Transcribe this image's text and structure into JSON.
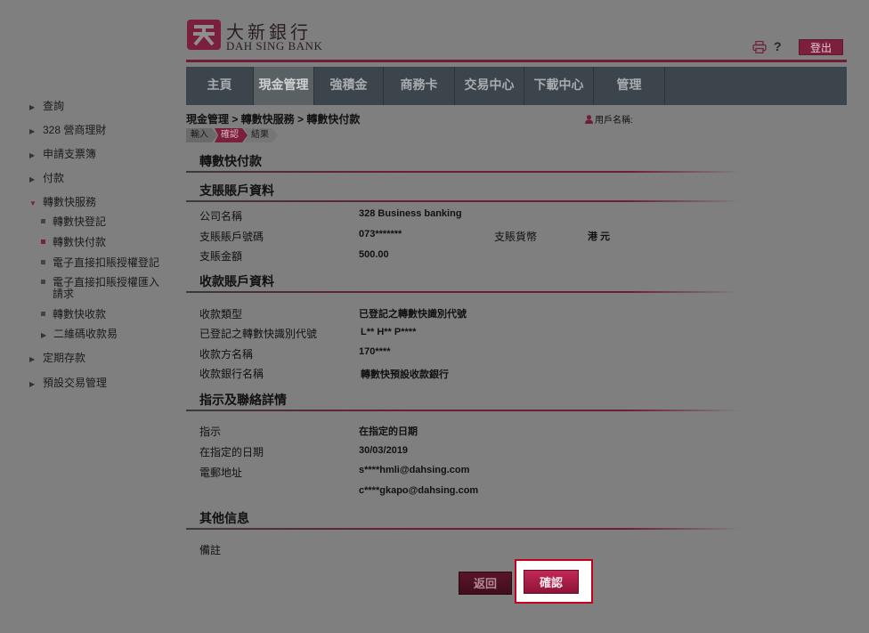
{
  "brand": {
    "name_cn": "大新銀行",
    "name_en": "DAH SING BANK",
    "color": "#7a1f3c"
  },
  "header": {
    "help_label": "?",
    "logout_label": "登出",
    "print_icon": "printer-icon"
  },
  "nav": {
    "items": [
      {
        "label": "主頁"
      },
      {
        "label": "現金管理"
      },
      {
        "label": "強積金"
      },
      {
        "label": "商務卡"
      },
      {
        "label": "交易中心"
      },
      {
        "label": "下載中心"
      },
      {
        "label": "管理"
      }
    ],
    "active": "現金管理"
  },
  "breadcrumb": "現金管理 > 轉數快服務 > 轉數快付款",
  "user": {
    "label": "用戶名稱:"
  },
  "steps": [
    "輸入",
    "確認",
    "結果"
  ],
  "page_title": "轉數快付款",
  "debit": {
    "title": "支賬賬戶資料",
    "company_label": "公司名稱",
    "company_value": "328 Business banking",
    "account_label": "支賬賬戶號碼",
    "account_value": "073*******",
    "currency_label": "支賬貨幣",
    "currency_value": "港 元",
    "amount_label": "支賬金額",
    "amount_value": "500.00"
  },
  "payee": {
    "title": "收款賬戶資料",
    "type_label": "收款類型",
    "type_value": "已登記之轉數快識別代號",
    "proxy_label": "已登記之轉數快識別代號",
    "proxy_value": "L** H** P****",
    "name_label": "收款方名稱",
    "name_value": "170****",
    "bank_label": "收款銀行名稱",
    "bank_value": "轉數快預設收款銀行"
  },
  "instruction": {
    "title": "指示及聯絡詳情",
    "instr_label": "指示",
    "instr_value": "在指定的日期",
    "date_label": "在指定的日期",
    "date_value": "30/03/2019",
    "email_label": "電郵地址",
    "email_1": "s****hmli@dahsing.com",
    "email_2": "c****gkapo@dahsing.com"
  },
  "other": {
    "title": "其他信息",
    "remark_label": "備註"
  },
  "buttons": {
    "back": "返回",
    "confirm": "確認"
  },
  "sidebar": {
    "items": [
      {
        "label": "查詢"
      },
      {
        "label": "328 營商理財"
      },
      {
        "label": "申請支票簿"
      },
      {
        "label": "付款"
      },
      {
        "label": "轉數快服務"
      },
      {
        "label": "定期存款"
      },
      {
        "label": "預設交易管理"
      }
    ],
    "fps_sub": [
      {
        "label": "轉數快登記"
      },
      {
        "label": "轉數快付款"
      },
      {
        "label": "電子直接扣賬授權登記"
      },
      {
        "label": "電子直接扣賬授權匯入"
      },
      {
        "label": "請求"
      },
      {
        "label": "轉數快收款"
      },
      {
        "label": "二維碼收款易"
      }
    ]
  }
}
